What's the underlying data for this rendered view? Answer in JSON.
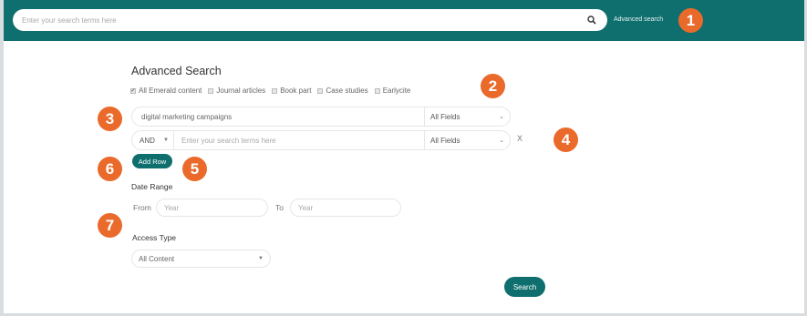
{
  "header": {
    "search_placeholder": "Enter your search terms here",
    "advanced_link": "Advanced search",
    "search_icon": "search-icon"
  },
  "main": {
    "title": "Advanced Search",
    "filters": [
      {
        "label": "All Emerald content",
        "checked": true
      },
      {
        "label": "Journal articles",
        "checked": false
      },
      {
        "label": "Book part",
        "checked": false
      },
      {
        "label": "Case studies",
        "checked": false
      },
      {
        "label": "Earlycite",
        "checked": false
      }
    ],
    "rows": [
      {
        "value": "digital marketing campaigns",
        "field": "All Fields"
      },
      {
        "operator": "AND",
        "placeholder": "Enter your search terms here",
        "field": "All Fields",
        "remove": "X"
      }
    ],
    "add_row": "Add Row",
    "date_range": {
      "label": "Date Range",
      "from_label": "From",
      "from_placeholder": "Year",
      "to_label": "To",
      "to_placeholder": "Year"
    },
    "access": {
      "label": "Access Type",
      "selected": "All Content"
    },
    "search_button": "Search"
  },
  "badges": [
    "1",
    "2",
    "3",
    "4",
    "5",
    "6",
    "7"
  ],
  "colors": {
    "brand": "#0e6f6e",
    "badge": "#ea6a2b"
  }
}
